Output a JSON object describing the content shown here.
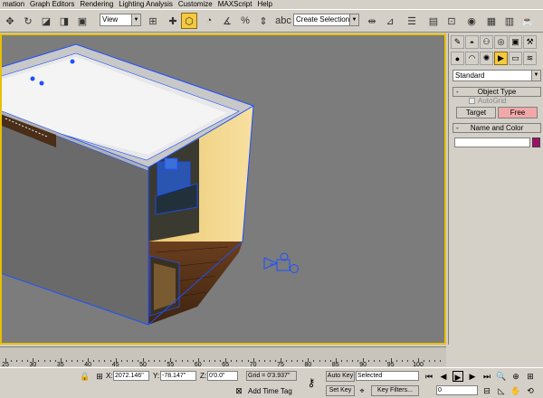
{
  "menu": {
    "items": [
      "mation",
      "Graph Editors",
      "Rendering",
      "Lighting Analysis",
      "Customize",
      "MAXScript",
      "Help"
    ]
  },
  "toolbar": {
    "view_label": "View",
    "selection_set_placeholder": "Create Selection Set"
  },
  "command_panel": {
    "category": "Standard",
    "object_type": {
      "title": "Object Type",
      "autogrid_label": "AutoGrid",
      "target_label": "Target",
      "free_label": "Free"
    },
    "name_and_color": {
      "title": "Name and Color",
      "name_value": "",
      "color": "#a0106a"
    }
  },
  "timeline": {
    "ticks": [
      "25",
      "30",
      "35",
      "40",
      "45",
      "50",
      "55",
      "60",
      "65",
      "70",
      "75",
      "80",
      "85",
      "90",
      "95",
      "100"
    ]
  },
  "status": {
    "x_label": "X:",
    "x_value": "2072.146\"",
    "y_label": "Y:",
    "y_value": "-78.147\"",
    "z_label": "Z:",
    "z_value": "0'0.0\"",
    "grid_label": "Grid = 0'3.937\"",
    "add_time_tag": "Add Time Tag",
    "auto_key": "Auto Key",
    "selected": "Selected",
    "set_key": "Set Key",
    "key_filters": "Key Filters...",
    "frame_value": "0"
  },
  "colors": {
    "viewport_border": "#e8c000",
    "active_button": "#f5c940",
    "free_button": "#f0a8a8",
    "selection_wire": "#1e50ff"
  }
}
